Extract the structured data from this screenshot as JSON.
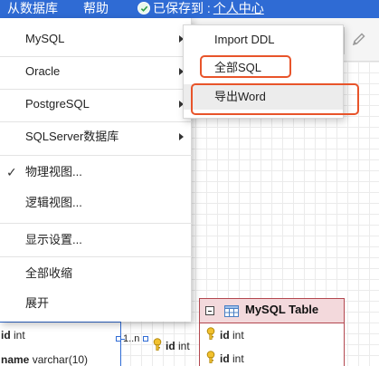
{
  "menubar": {
    "items": [
      "从数据库",
      "帮助"
    ],
    "saved_text": "已保存到 :",
    "saved_link": "个人中心"
  },
  "main_menu": {
    "items": [
      {
        "label": "MySQL",
        "submenu": true
      },
      {
        "label": "Oracle",
        "submenu": true
      },
      {
        "label": "PostgreSQL",
        "submenu": true
      },
      {
        "label": "SQLServer数据库",
        "submenu": true
      },
      {
        "label": "物理视图...",
        "checked": true
      },
      {
        "label": "逻辑视图..."
      },
      {
        "label": "显示设置..."
      },
      {
        "label": "全部收缩"
      },
      {
        "label": "展开"
      }
    ]
  },
  "submenu": {
    "items": [
      "Import DDL",
      "全部SQL",
      "导出Word"
    ],
    "highlighted": [
      "全部SQL",
      "导出Word"
    ],
    "highlight_color": "#e8542a"
  },
  "canvas": {
    "left_table_fields": [
      {
        "name": "id",
        "type": "int"
      },
      {
        "name": "name",
        "type": "varchar(10)"
      }
    ],
    "relation_label": "1..n",
    "relation_field": {
      "name": "id",
      "type": "int"
    },
    "right_table": {
      "title": "MySQL Table",
      "fields": [
        {
          "name": "id",
          "type": "int"
        },
        {
          "name": "id",
          "type": "int"
        }
      ]
    }
  },
  "colors": {
    "menubar": "#2f6bd4",
    "table_header": "#f3d9dc",
    "table_border": "#b3474f"
  }
}
